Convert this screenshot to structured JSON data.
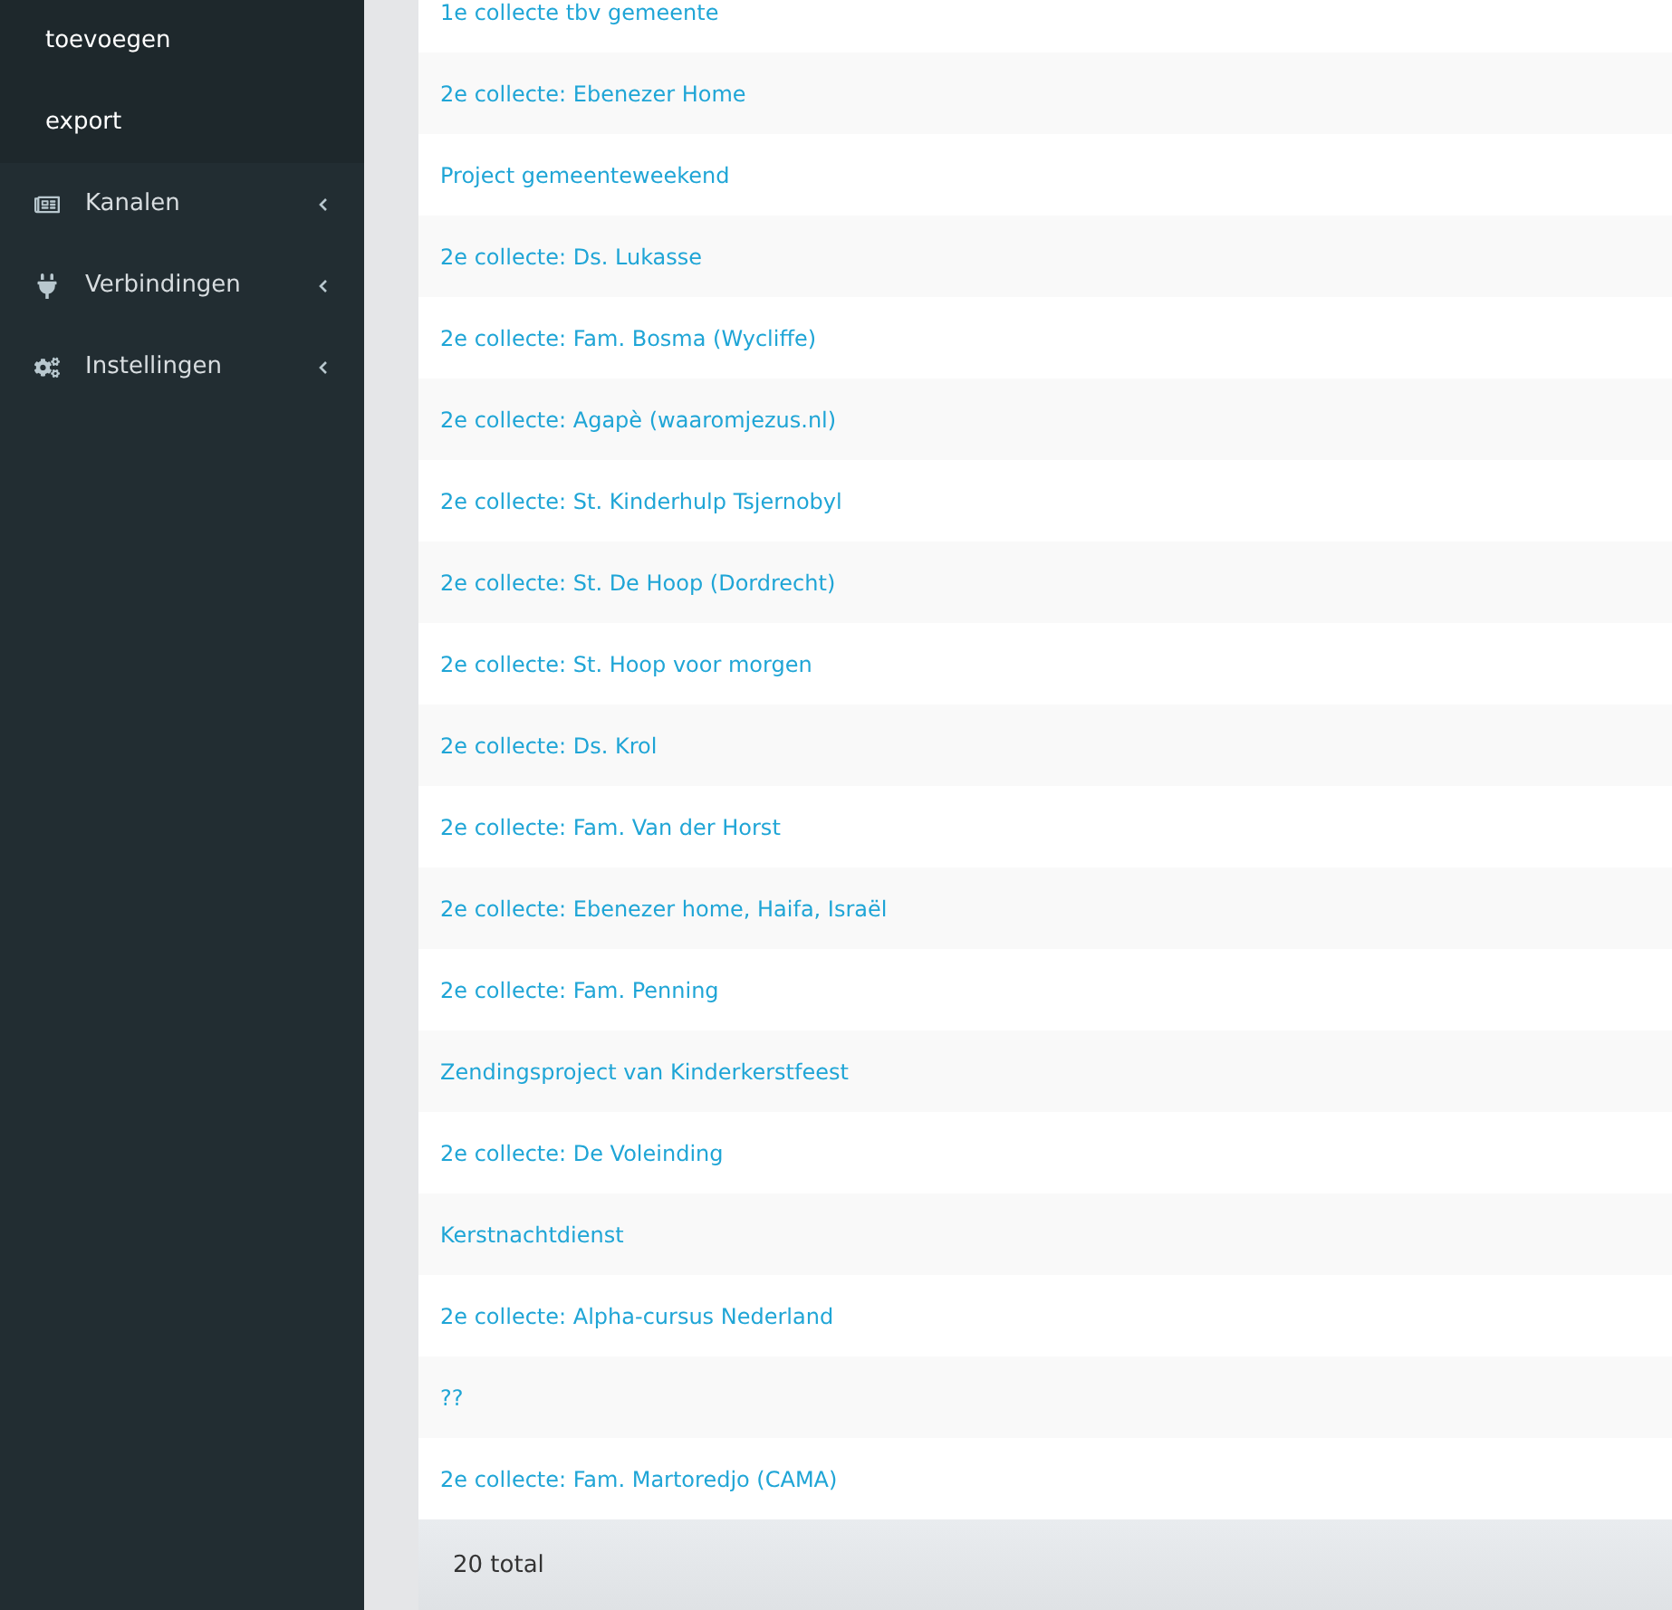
{
  "sidebar": {
    "submenu": [
      {
        "label": "toevoegen"
      },
      {
        "label": "export"
      }
    ],
    "items": [
      {
        "label": "Kanalen",
        "expanded": false
      },
      {
        "label": "Verbindingen",
        "expanded": false
      },
      {
        "label": "Instellingen",
        "expanded": false
      }
    ]
  },
  "table": {
    "rows": [
      "1e collecte tbv gemeente",
      "2e collecte: Ebenezer Home",
      "Project gemeenteweekend",
      "2e collecte: Ds. Lukasse",
      "2e collecte: Fam. Bosma (Wycliffe)",
      "2e collecte: Agapè (waaromjezus.nl)",
      "2e collecte: St. Kinderhulp Tsjernobyl",
      "2e collecte: St. De Hoop (Dordrecht)",
      "2e collecte: St. Hoop voor morgen",
      "2e collecte: Ds. Krol",
      "2e collecte: Fam. Van der Horst",
      "2e collecte: Ebenezer home, Haifa, Israël",
      "2e collecte: Fam. Penning",
      "Zendingsproject van Kinderkerstfeest",
      "2e collecte: De Voleinding",
      "Kerstnachtdienst",
      "2e collecte: Alpha-cursus Nederland",
      "??",
      "2e collecte: Fam. Martoredjo (CAMA)"
    ],
    "footer": "20 total"
  }
}
